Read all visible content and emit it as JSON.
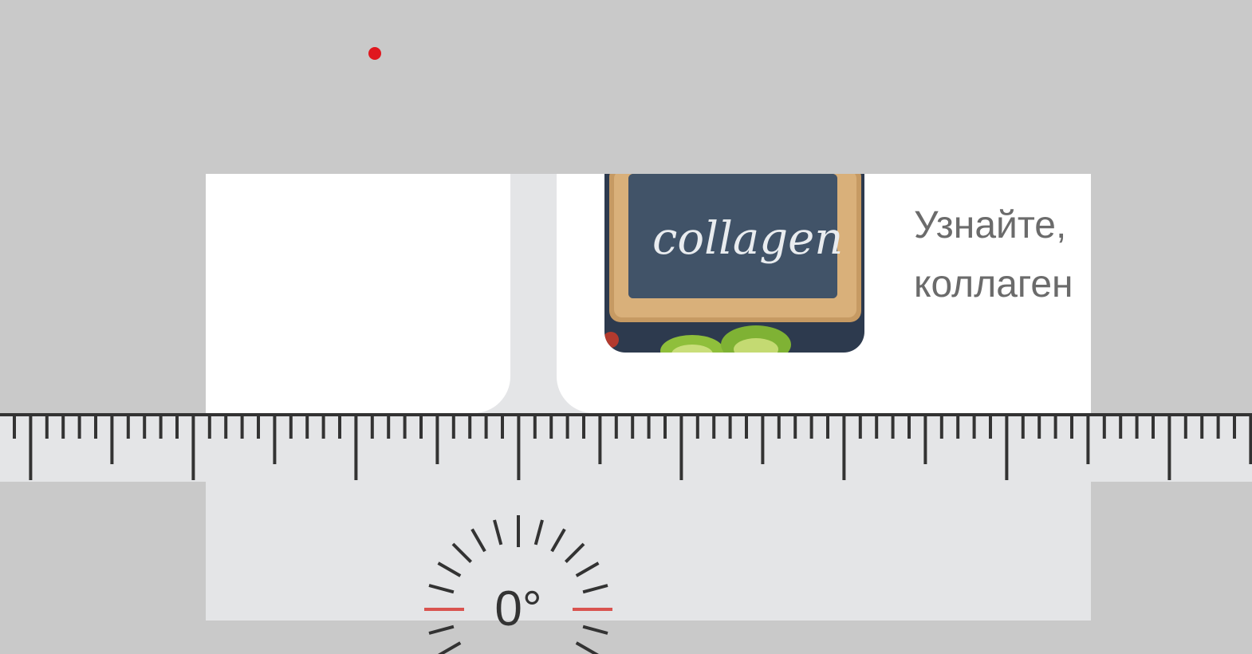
{
  "indicator": {
    "color": "#e0181f"
  },
  "content": {
    "thumbnail": {
      "caption": "collagen",
      "icon": "collagen-chalkboard-image"
    },
    "card_text": {
      "line1": "Узнайте,",
      "line2": "коллаген"
    }
  },
  "ruler": {
    "icon": "ruler-icon"
  },
  "protractor": {
    "angle": "0°",
    "icon": "protractor-icon",
    "accent_color": "#d9534f"
  }
}
